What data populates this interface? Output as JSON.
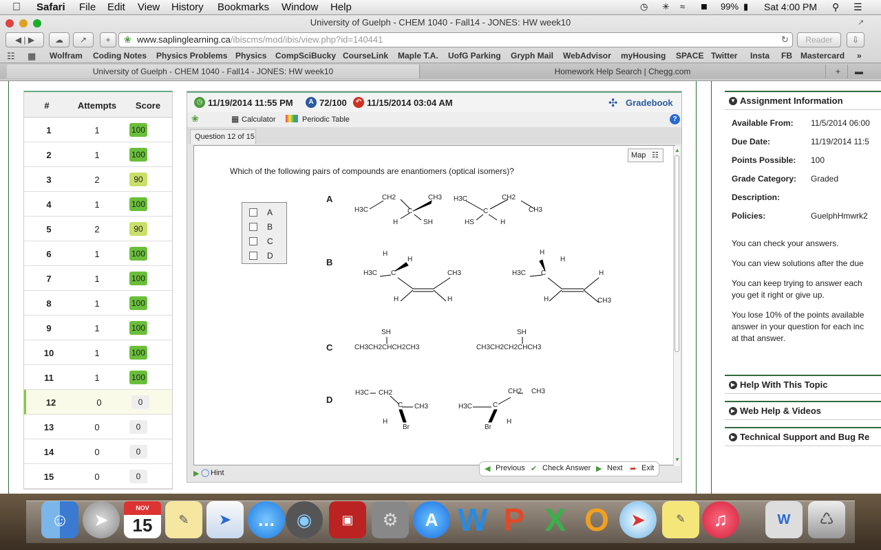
{
  "menubar": {
    "app": "Safari",
    "items": [
      "File",
      "Edit",
      "View",
      "History",
      "Bookmarks",
      "Window",
      "Help"
    ],
    "battery": "99%",
    "clock": "Sat 4:00 PM"
  },
  "window": {
    "title": "University of Guelph - CHEM 1040 - Fall14 - JONES: HW week10",
    "url_host": "www.saplinglearning.ca",
    "url_path": "/ibiscms/mod/ibis/view.php?id=140441",
    "reader_label": "Reader"
  },
  "bookmarks": [
    "Wolfram",
    "Coding Notes",
    "Physics Problems",
    "Physics",
    "CompSciBucky",
    "CourseLink",
    "Maple T.A.",
    "UofG Parking",
    "Gryph Mail",
    "WebAdvisor",
    "myHousing",
    "SPACE",
    "Twitter",
    "Insta",
    "FB",
    "Mastercard"
  ],
  "tabs": [
    {
      "label": "University of Guelph - CHEM 1040 - Fall14 - JONES: HW week10"
    },
    {
      "label": "Homework Help Search | Chegg.com"
    }
  ],
  "score_table": {
    "headers": [
      "#",
      "Attempts",
      "Score"
    ],
    "rows": [
      {
        "num": "1",
        "attempts": "1",
        "score": "100"
      },
      {
        "num": "2",
        "attempts": "1",
        "score": "100"
      },
      {
        "num": "3",
        "attempts": "2",
        "score": "90"
      },
      {
        "num": "4",
        "attempts": "1",
        "score": "100"
      },
      {
        "num": "5",
        "attempts": "2",
        "score": "90"
      },
      {
        "num": "6",
        "attempts": "1",
        "score": "100"
      },
      {
        "num": "7",
        "attempts": "1",
        "score": "100"
      },
      {
        "num": "8",
        "attempts": "1",
        "score": "100"
      },
      {
        "num": "9",
        "attempts": "1",
        "score": "100"
      },
      {
        "num": "10",
        "attempts": "1",
        "score": "100"
      },
      {
        "num": "11",
        "attempts": "1",
        "score": "100"
      },
      {
        "num": "12",
        "attempts": "0",
        "score": "0"
      },
      {
        "num": "13",
        "attempts": "0",
        "score": "0"
      },
      {
        "num": "14",
        "attempts": "0",
        "score": "0"
      },
      {
        "num": "15",
        "attempts": "0",
        "score": "0"
      }
    ],
    "current_index": 11
  },
  "question_panel": {
    "due": "11/19/2014 11:55 PM",
    "score": "72/100",
    "last_saved": "11/15/2014 03:04 AM",
    "gradebook": "Gradebook",
    "calculator": "Calculator",
    "periodic_table": "Periodic Table",
    "question_tab": "Question 12 of 15",
    "map": "Map",
    "question_text": "Which of the following pairs of compounds are enantiomers (optical isomers)?",
    "choices": [
      "A",
      "B",
      "C",
      "D"
    ],
    "pair_labels": [
      "A",
      "B",
      "C",
      "D"
    ],
    "hint": "Hint",
    "previous": "Previous",
    "check_answer": "Check Answer",
    "next": "Next",
    "exit": "Exit"
  },
  "structures": {
    "ch2": "CH2",
    "ch3": "CH3",
    "h3c": "H3C",
    "h": "H",
    "sh": "SH",
    "hs": "HS",
    "c": "C",
    "br": "Br",
    "c_left": "CH3CH2CHCH2CH3",
    "c_right": "CH3CH2CH2CHCH3"
  },
  "sidebar": {
    "assignment_header": "Assignment Information",
    "available_label": "Available From:",
    "available_value": "11/5/2014 06:00",
    "due_label": "Due Date:",
    "due_value": "11/19/2014 11:5",
    "points_label": "Points Possible:",
    "points_value": "100",
    "grade_cat_label": "Grade Category:",
    "grade_cat_value": "Graded",
    "desc_label": "Description:",
    "policies_label": "Policies:",
    "policies_value": "GuelphHmwrk2",
    "p1": "You can check your answers.",
    "p2": "You can view solutions after the due",
    "p3a": "You can keep trying to answer each",
    "p3b": "you get it right or give up.",
    "p4a": "You lose 10% of the points available",
    "p4b": "answer in your question for each inc",
    "p4c": "at that answer.",
    "help_topic": "Help With This Topic",
    "web_help": "Web Help & Videos",
    "tech_support": "Technical Support and Bug Re"
  },
  "dock": {
    "calendar_month": "NOV",
    "calendar_day": "15"
  },
  "colors": {
    "score_full": "#6abf3a",
    "score_partial": "#c8e06a",
    "score_zero": "#eeeeee",
    "accent_green": "#2d6a3a"
  }
}
